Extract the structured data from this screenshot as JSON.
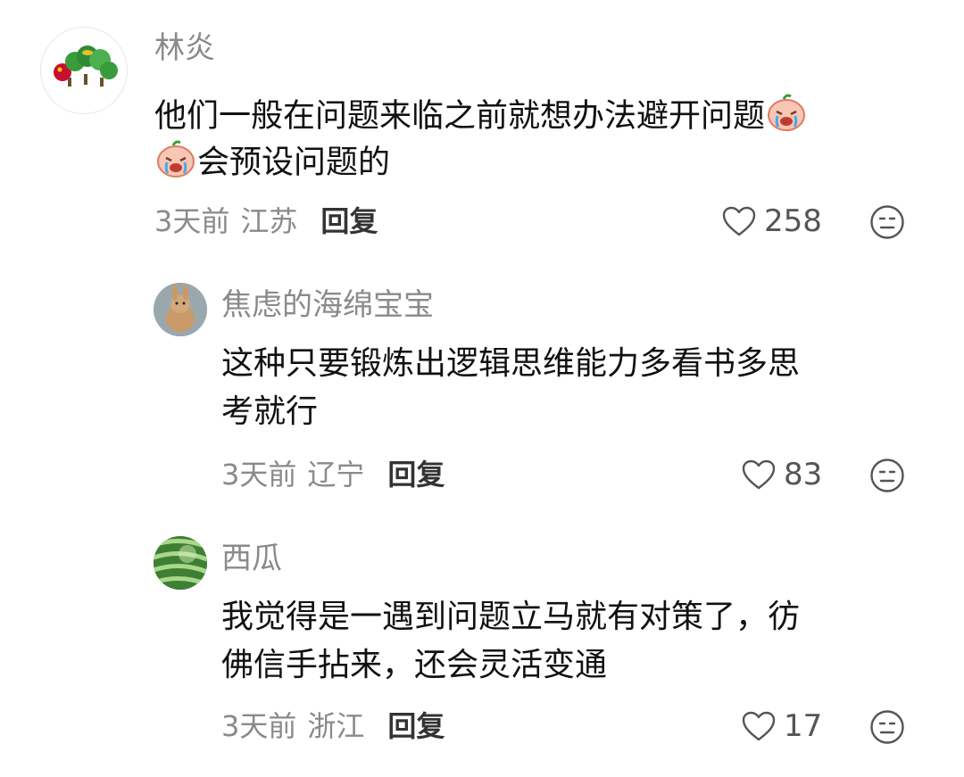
{
  "comments": [
    {
      "username": "林炎",
      "avatar_icon": "caterpillar-avatar",
      "line1_text": "他们一般在问题来临之前就想办法避开问题",
      "line1_emoji": "crying-face-emoji",
      "line2_emoji": "crying-face-emoji",
      "line2_text": "会预设问题的",
      "time": "3天前",
      "location": "江苏",
      "reply_label": "回复",
      "likes": "258"
    },
    {
      "username": "焦虑的海绵宝宝",
      "avatar_icon": "rabbit-avatar",
      "line1_text": "这种只要锻炼出逻辑思维能力多看书多思",
      "line2_text": "考就行",
      "time": "3天前",
      "location": "辽宁",
      "reply_label": "回复",
      "likes": "83"
    },
    {
      "username": "西瓜",
      "avatar_icon": "watermelon-avatar",
      "line1_text": "我觉得是一遇到问题立马就有对策了，彷",
      "line2_text": "佛信手拈来，还会灵活变通",
      "time": "3天前",
      "location": "浙江",
      "reply_label": "回复",
      "likes": "17"
    }
  ],
  "colors": {
    "secondary_text": "#8a8a8a",
    "primary_text": "#111111",
    "reply_text": "#333333",
    "icon_stroke": "#555555"
  },
  "icons": {
    "like": "heart-outline-icon",
    "dislike": "neutral-face-icon"
  }
}
